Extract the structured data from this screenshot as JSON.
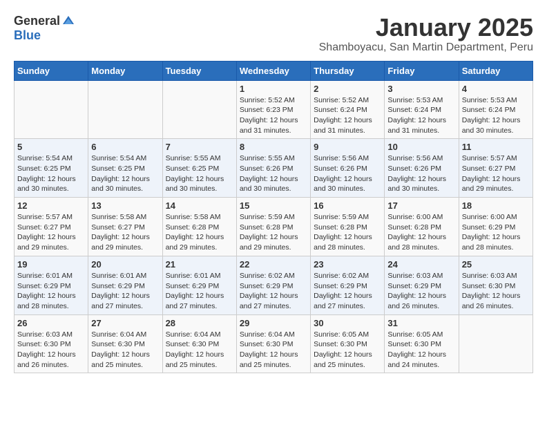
{
  "logo": {
    "general": "General",
    "blue": "Blue"
  },
  "title": "January 2025",
  "subtitle": "Shamboyacu, San Martin Department, Peru",
  "days_header": [
    "Sunday",
    "Monday",
    "Tuesday",
    "Wednesday",
    "Thursday",
    "Friday",
    "Saturday"
  ],
  "weeks": [
    [
      {
        "num": "",
        "info": ""
      },
      {
        "num": "",
        "info": ""
      },
      {
        "num": "",
        "info": ""
      },
      {
        "num": "1",
        "info": "Sunrise: 5:52 AM\nSunset: 6:23 PM\nDaylight: 12 hours\nand 31 minutes."
      },
      {
        "num": "2",
        "info": "Sunrise: 5:52 AM\nSunset: 6:24 PM\nDaylight: 12 hours\nand 31 minutes."
      },
      {
        "num": "3",
        "info": "Sunrise: 5:53 AM\nSunset: 6:24 PM\nDaylight: 12 hours\nand 31 minutes."
      },
      {
        "num": "4",
        "info": "Sunrise: 5:53 AM\nSunset: 6:24 PM\nDaylight: 12 hours\nand 30 minutes."
      }
    ],
    [
      {
        "num": "5",
        "info": "Sunrise: 5:54 AM\nSunset: 6:25 PM\nDaylight: 12 hours\nand 30 minutes."
      },
      {
        "num": "6",
        "info": "Sunrise: 5:54 AM\nSunset: 6:25 PM\nDaylight: 12 hours\nand 30 minutes."
      },
      {
        "num": "7",
        "info": "Sunrise: 5:55 AM\nSunset: 6:25 PM\nDaylight: 12 hours\nand 30 minutes."
      },
      {
        "num": "8",
        "info": "Sunrise: 5:55 AM\nSunset: 6:26 PM\nDaylight: 12 hours\nand 30 minutes."
      },
      {
        "num": "9",
        "info": "Sunrise: 5:56 AM\nSunset: 6:26 PM\nDaylight: 12 hours\nand 30 minutes."
      },
      {
        "num": "10",
        "info": "Sunrise: 5:56 AM\nSunset: 6:26 PM\nDaylight: 12 hours\nand 30 minutes."
      },
      {
        "num": "11",
        "info": "Sunrise: 5:57 AM\nSunset: 6:27 PM\nDaylight: 12 hours\nand 29 minutes."
      }
    ],
    [
      {
        "num": "12",
        "info": "Sunrise: 5:57 AM\nSunset: 6:27 PM\nDaylight: 12 hours\nand 29 minutes."
      },
      {
        "num": "13",
        "info": "Sunrise: 5:58 AM\nSunset: 6:27 PM\nDaylight: 12 hours\nand 29 minutes."
      },
      {
        "num": "14",
        "info": "Sunrise: 5:58 AM\nSunset: 6:28 PM\nDaylight: 12 hours\nand 29 minutes."
      },
      {
        "num": "15",
        "info": "Sunrise: 5:59 AM\nSunset: 6:28 PM\nDaylight: 12 hours\nand 29 minutes."
      },
      {
        "num": "16",
        "info": "Sunrise: 5:59 AM\nSunset: 6:28 PM\nDaylight: 12 hours\nand 28 minutes."
      },
      {
        "num": "17",
        "info": "Sunrise: 6:00 AM\nSunset: 6:28 PM\nDaylight: 12 hours\nand 28 minutes."
      },
      {
        "num": "18",
        "info": "Sunrise: 6:00 AM\nSunset: 6:29 PM\nDaylight: 12 hours\nand 28 minutes."
      }
    ],
    [
      {
        "num": "19",
        "info": "Sunrise: 6:01 AM\nSunset: 6:29 PM\nDaylight: 12 hours\nand 28 minutes."
      },
      {
        "num": "20",
        "info": "Sunrise: 6:01 AM\nSunset: 6:29 PM\nDaylight: 12 hours\nand 27 minutes."
      },
      {
        "num": "21",
        "info": "Sunrise: 6:01 AM\nSunset: 6:29 PM\nDaylight: 12 hours\nand 27 minutes."
      },
      {
        "num": "22",
        "info": "Sunrise: 6:02 AM\nSunset: 6:29 PM\nDaylight: 12 hours\nand 27 minutes."
      },
      {
        "num": "23",
        "info": "Sunrise: 6:02 AM\nSunset: 6:29 PM\nDaylight: 12 hours\nand 27 minutes."
      },
      {
        "num": "24",
        "info": "Sunrise: 6:03 AM\nSunset: 6:29 PM\nDaylight: 12 hours\nand 26 minutes."
      },
      {
        "num": "25",
        "info": "Sunrise: 6:03 AM\nSunset: 6:30 PM\nDaylight: 12 hours\nand 26 minutes."
      }
    ],
    [
      {
        "num": "26",
        "info": "Sunrise: 6:03 AM\nSunset: 6:30 PM\nDaylight: 12 hours\nand 26 minutes."
      },
      {
        "num": "27",
        "info": "Sunrise: 6:04 AM\nSunset: 6:30 PM\nDaylight: 12 hours\nand 25 minutes."
      },
      {
        "num": "28",
        "info": "Sunrise: 6:04 AM\nSunset: 6:30 PM\nDaylight: 12 hours\nand 25 minutes."
      },
      {
        "num": "29",
        "info": "Sunrise: 6:04 AM\nSunset: 6:30 PM\nDaylight: 12 hours\nand 25 minutes."
      },
      {
        "num": "30",
        "info": "Sunrise: 6:05 AM\nSunset: 6:30 PM\nDaylight: 12 hours\nand 25 minutes."
      },
      {
        "num": "31",
        "info": "Sunrise: 6:05 AM\nSunset: 6:30 PM\nDaylight: 12 hours\nand 24 minutes."
      },
      {
        "num": "",
        "info": ""
      }
    ]
  ]
}
